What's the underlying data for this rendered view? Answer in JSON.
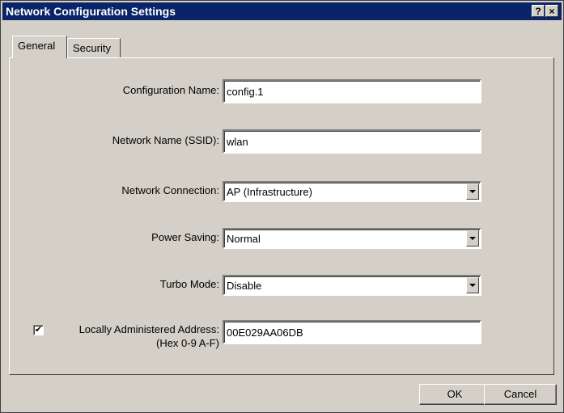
{
  "window": {
    "title": "Network Configuration Settings",
    "help_glyph": "?",
    "close_glyph": "×"
  },
  "tabs": [
    {
      "label": "General",
      "active": true
    },
    {
      "label": "Security",
      "active": false
    }
  ],
  "form": {
    "config_name": {
      "label": "Configuration Name:",
      "value": "config.1"
    },
    "ssid": {
      "label": "Network Name (SSID):",
      "value": "wlan"
    },
    "connection": {
      "label": "Network Connection:",
      "value": "AP (Infrastructure)"
    },
    "power_saving": {
      "label": "Power Saving:",
      "value": "Normal"
    },
    "turbo_mode": {
      "label": "Turbo Mode:",
      "value": "Disable"
    },
    "laa": {
      "checked": true,
      "check_glyph": "✔",
      "label_line1": "Locally Administered Address:",
      "label_line2": "(Hex 0-9 A-F)",
      "value": "00E029AA06DB"
    }
  },
  "buttons": {
    "ok": "OK",
    "cancel": "Cancel"
  },
  "colors": {
    "face": "#d4d0c8",
    "titlebar": "#0a246a",
    "field_bg": "#ffffff"
  }
}
